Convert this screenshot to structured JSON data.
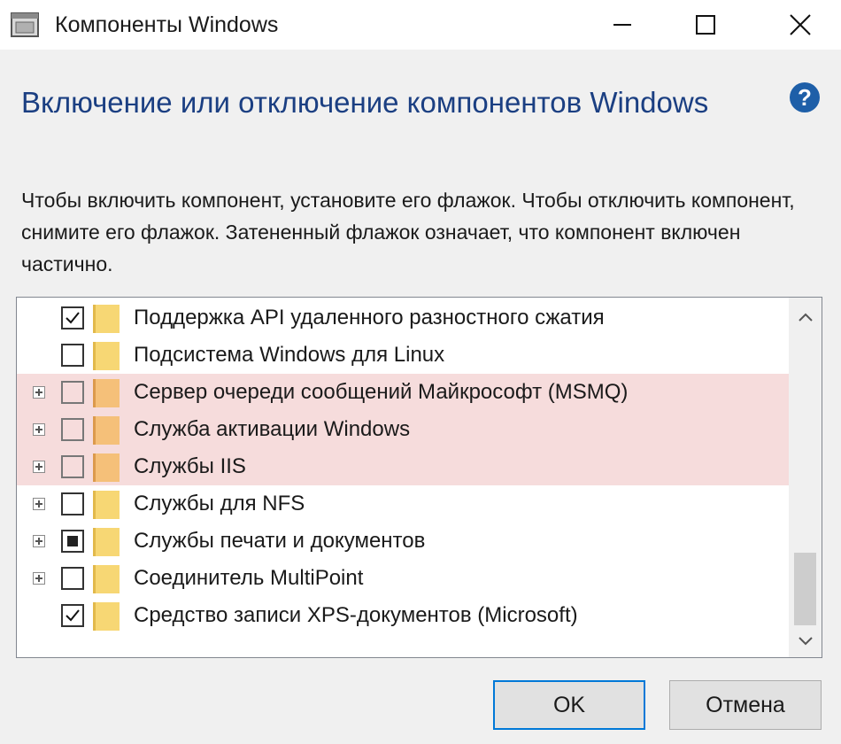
{
  "window": {
    "title": "Компоненты Windows",
    "icon": "windows-features-app-icon",
    "controls": [
      "minimize-icon",
      "maximize-icon",
      "close-icon"
    ]
  },
  "heading": "Включение или отключение компонентов Windows",
  "description": "Чтобы включить компонент, установите его флажок. Чтобы отключить компонент, снимите его флажок. Затененный флажок означает, что компонент включен частично.",
  "features": [
    {
      "label": "Поддержка API удаленного разностного сжатия",
      "state": "checked",
      "expandable": false,
      "highlighted": false
    },
    {
      "label": "Подсистема Windows для Linux",
      "state": "unchecked",
      "expandable": false,
      "highlighted": false
    },
    {
      "label": "Сервер очереди сообщений Майкрософт (MSMQ)",
      "state": "unchecked",
      "expandable": true,
      "highlighted": true
    },
    {
      "label": "Служба активации Windows",
      "state": "unchecked",
      "expandable": true,
      "highlighted": true
    },
    {
      "label": "Службы IIS",
      "state": "unchecked",
      "expandable": true,
      "highlighted": true
    },
    {
      "label": "Службы для NFS",
      "state": "unchecked",
      "expandable": true,
      "highlighted": false
    },
    {
      "label": "Службы печати и документов",
      "state": "partial",
      "expandable": true,
      "highlighted": false
    },
    {
      "label": "Соединитель MultiPoint",
      "state": "unchecked",
      "expandable": true,
      "highlighted": false
    },
    {
      "label": "Средство записи XPS-документов (Microsoft)",
      "state": "checked",
      "expandable": false,
      "highlighted": false
    }
  ],
  "buttons": {
    "ok": "OK",
    "cancel": "Отмена"
  },
  "colors": {
    "heading": "#1b3f82",
    "highlight_row": "#f6dcdc",
    "default_button_border": "#0078d7",
    "help_icon": "#1e5fa8"
  }
}
